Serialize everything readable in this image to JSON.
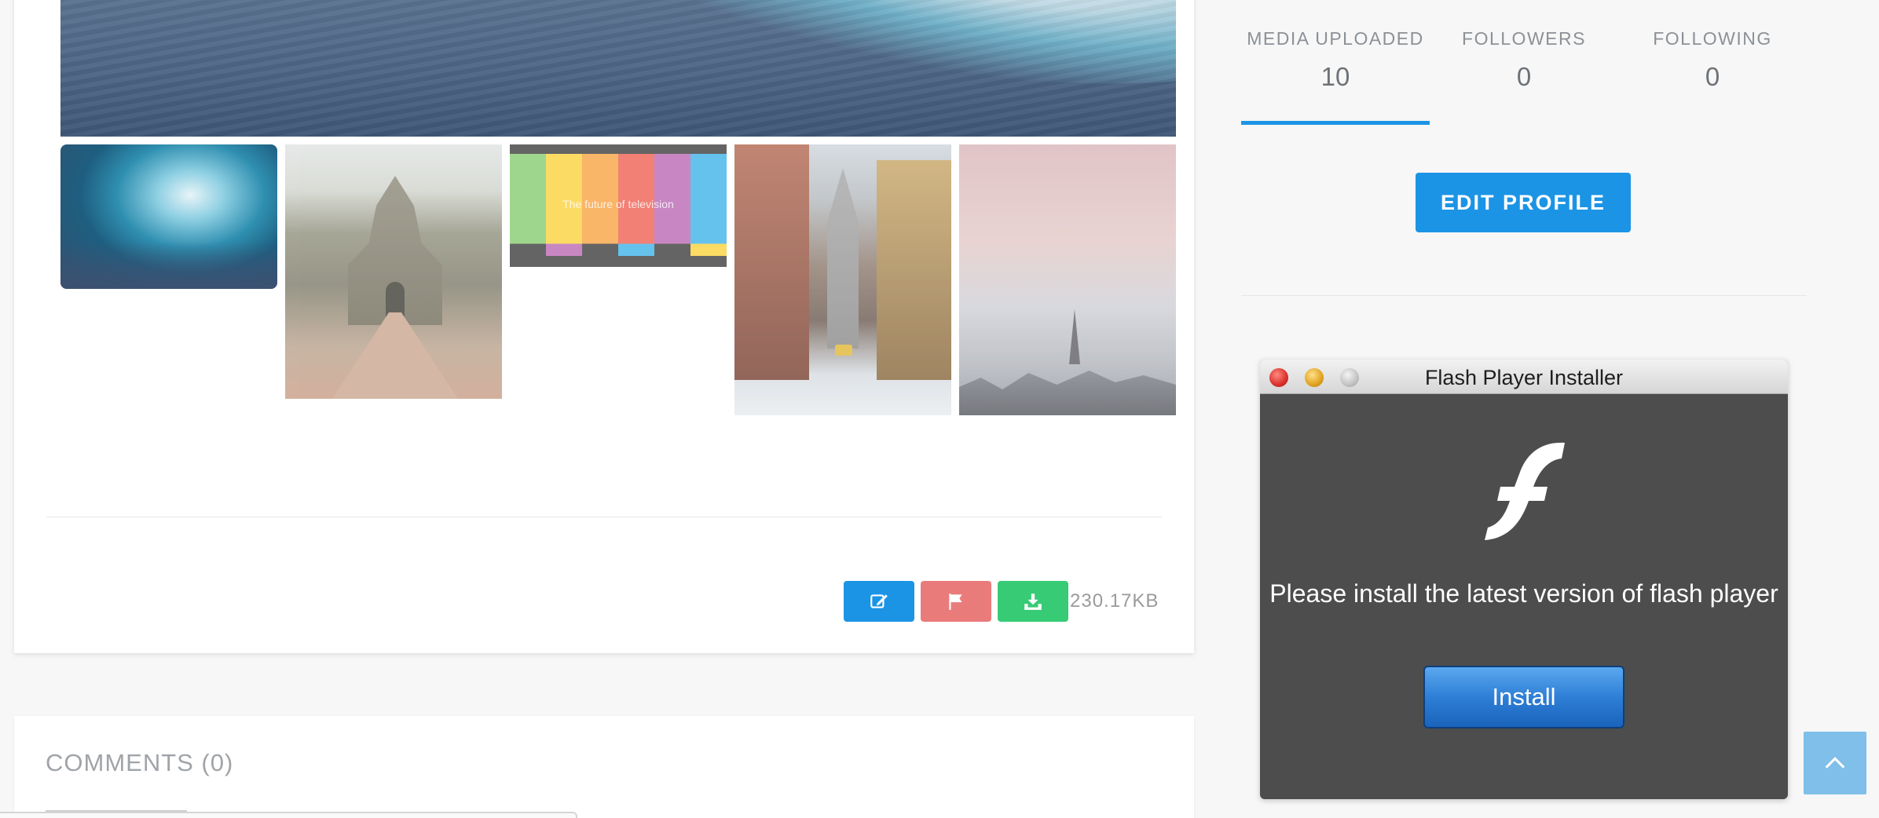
{
  "gallery": {
    "thumbnail_caption": "The future of television",
    "tv_bar_colors": [
      "#8fcf7a",
      "#fbd54a",
      "#f8a94e",
      "#f06b5c",
      "#bf73b8",
      "#4bb8ea"
    ],
    "tv_bar_bottom_colors": [
      "#494949",
      "#bf73b8",
      "#494949",
      "#4bb8ea",
      "#494949",
      "#fbd54a"
    ]
  },
  "actions": {
    "edit_icon": "edit-icon",
    "flag_icon": "flag-icon",
    "download_icon": "download-icon",
    "file_size": "230.17KB"
  },
  "comments": {
    "title": "COMMENTS (0)"
  },
  "profile": {
    "stats": [
      {
        "label": "MEDIA UPLOADED",
        "value": "10"
      },
      {
        "label": "FOLLOWERS",
        "value": "0"
      },
      {
        "label": "FOLLOWING",
        "value": "0"
      }
    ],
    "edit_button": "EDIT PROFILE"
  },
  "flash_popup": {
    "title": "Flash Player Installer",
    "message": "Please install the latest version of flash player",
    "install_button": "Install"
  },
  "colors": {
    "accent": "#1c94e5",
    "flag": "#ea7b7b",
    "download": "#36cb74"
  }
}
